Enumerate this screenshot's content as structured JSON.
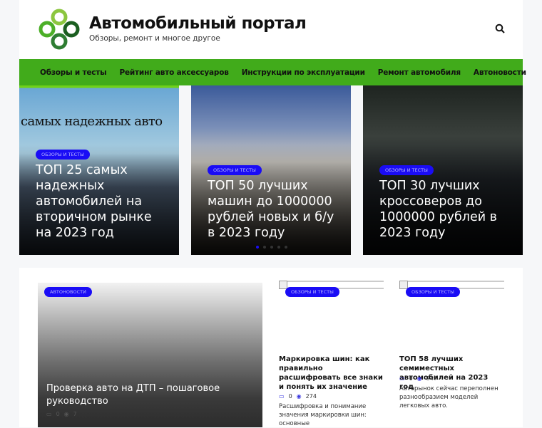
{
  "header": {
    "title": "Автомобильный портал",
    "subtitle": "Обзоры, ремонт и многое другое"
  },
  "nav": [
    "Обзоры и тесты",
    "Рейтинг авто аксессуаров",
    "Инструкции по эксплуатации",
    "Ремонт автомобиля",
    "Автоновости"
  ],
  "slider": [
    {
      "category": "ОБЗОРЫ И ТЕСТЫ",
      "title": "ТОП 25 самых надежных автомобилей на вторичном рынке на 2023 год",
      "image_text": "самых надежных авто"
    },
    {
      "category": "ОБЗОРЫ И ТЕСТЫ",
      "title": "ТОП 50 лучших машин до 1000000 рублей новых и б/у в 2023 году"
    },
    {
      "category": "ОБЗОРЫ И ТЕСТЫ",
      "title": "ТОП 30 лучших кроссоверов до 1000000 рублей в 2023 году"
    }
  ],
  "slider_active": 1,
  "featured": {
    "category": "АВТОНОВОСТИ",
    "title": "Проверка авто на ДТП – пошаговое руководство",
    "comments": "0",
    "views": "7"
  },
  "cards": [
    {
      "category": "ОБЗОРЫ И ТЕСТЫ",
      "title": "Маркировка шин: как правильно расшифровать все знаки и понять их значение",
      "comments": "0",
      "views": "274",
      "excerpt": "Расшифровка и понимание значения маркировки шин: основные"
    },
    {
      "category": "ОБЗОРЫ И ТЕСТЫ",
      "title": "ТОП 58 лучших семиместных автомобилей на 2023 год",
      "comments": "0",
      "views": "947",
      "excerpt": "Авторынок сейчас переполнен разнообразием моделей легковых авто."
    }
  ]
}
